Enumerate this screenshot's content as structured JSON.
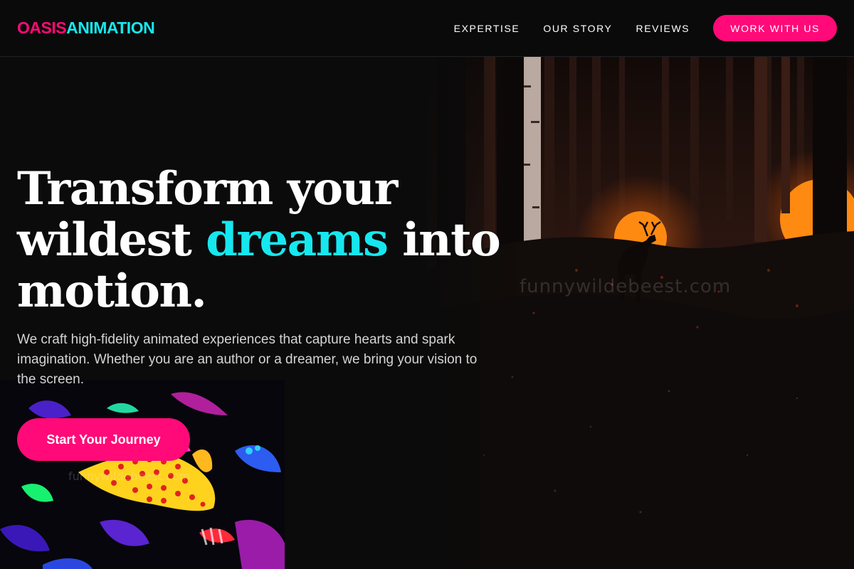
{
  "brand": {
    "part1": "OASIS",
    "part2": "ANIMATION",
    "color1": "#ff0a78",
    "color2": "#16e7ee"
  },
  "nav": {
    "items": [
      {
        "label": "EXPERTISE"
      },
      {
        "label": "OUR STORY"
      },
      {
        "label": "REVIEWS"
      }
    ],
    "cta_label": "WORK WITH US"
  },
  "hero": {
    "headline_start": "Transform your wildest ",
    "headline_accent": "dreams",
    "headline_end": " into motion.",
    "subtext": "We craft high-fidelity animated experiences that capture hearts and spark imagination. Whether you are an author or a dreamer, we bring your vision to the screen.",
    "cta_label": "Start Your Journey"
  },
  "images": {
    "forest_watermark": "funnywildebeest.com",
    "creatures_watermark": "funnywildebeest.com"
  },
  "colors": {
    "accent_pink": "#ff0a78",
    "accent_cyan": "#16e7ee",
    "background": "#0b0b0b"
  }
}
